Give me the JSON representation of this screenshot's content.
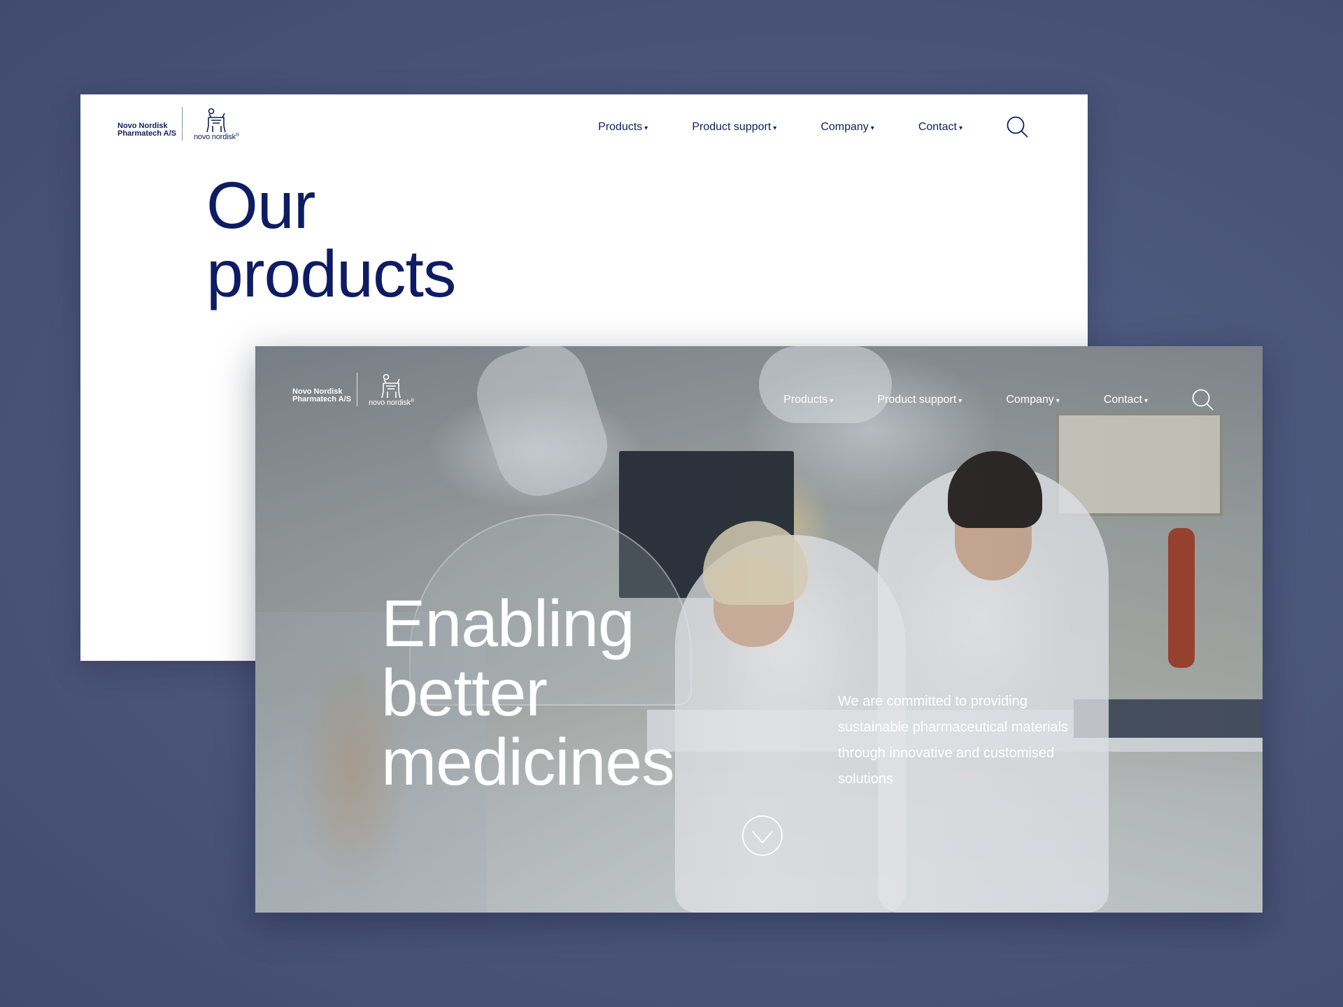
{
  "brand": {
    "company_line1": "Novo Nordisk",
    "company_line2": "Pharmatech A/S",
    "wordmark": "novo nordisk",
    "registered": "®"
  },
  "nav": {
    "items": [
      "Products",
      "Product support",
      "Company",
      "Contact"
    ],
    "caret": "▾",
    "search_icon": "search-icon"
  },
  "products_page": {
    "title_line1": "Our",
    "title_line2": "products"
  },
  "home_page": {
    "hero_line1": "Enabling",
    "hero_line2": "better",
    "hero_line3": "medicines",
    "tagline": "We are committed to providing sustainable pharmaceutical materials through innovative and customised solutions",
    "scroll_icon": "chevron-down-circle-icon"
  },
  "colors": {
    "background": "#4a5579",
    "navy": "#0e1c63",
    "white": "#ffffff"
  }
}
